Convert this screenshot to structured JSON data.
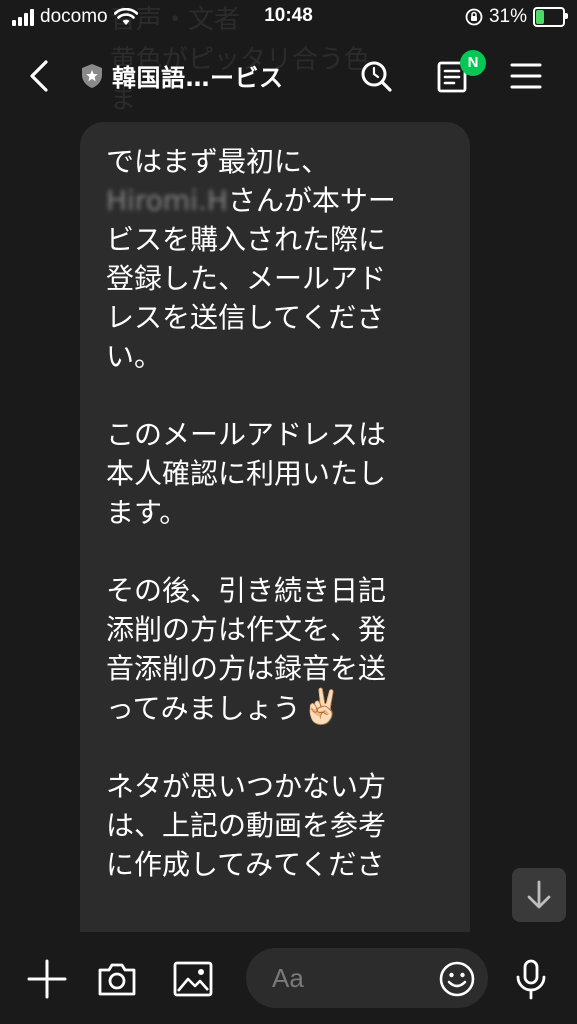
{
  "status_bar": {
    "carrier": "docomo",
    "time": "10:48",
    "battery_percent": "31%",
    "battery_level": 0.31
  },
  "background_text": {
    "line1": "音声・文者",
    "line2": "黄色がピッタリ合う色",
    "line3": "ま"
  },
  "header": {
    "title": "韓国語…ービス",
    "notes_badge": "N"
  },
  "message": {
    "line1": "ではまず最初に、",
    "name": "Hiromi.H",
    "after_name": "さんが本サー\nビスを購入された際に\n登録した、メールアド\nレスを送信してくださ\nい。\n\nこのメールアドレスは\n本人確認に利用いたし\nます。\n\nその後、引き続き日記\n添削の方は作文を、発\n音添削の方は録音を送\nってみましょう",
    "emoji": "✌🏻",
    "after_emoji": "\n\nネタが思いつかない方\nは、上記の動画を参考\nに作成してみてくださ"
  },
  "input_bar": {
    "placeholder": "Aa"
  },
  "colors": {
    "background": "#1a1a1a",
    "bubble": "#2c2c2c",
    "accent": "#06c755",
    "battery": "#4cd964"
  },
  "icons": {
    "back": "chevron-left-icon",
    "verified": "shield-star-icon",
    "search": "search-icon",
    "notes": "notes-icon",
    "menu": "hamburger-icon",
    "scroll_down": "arrow-down-icon",
    "plus": "plus-icon",
    "camera": "camera-icon",
    "image": "image-icon",
    "emoji": "smiley-icon",
    "mic": "microphone-icon"
  }
}
